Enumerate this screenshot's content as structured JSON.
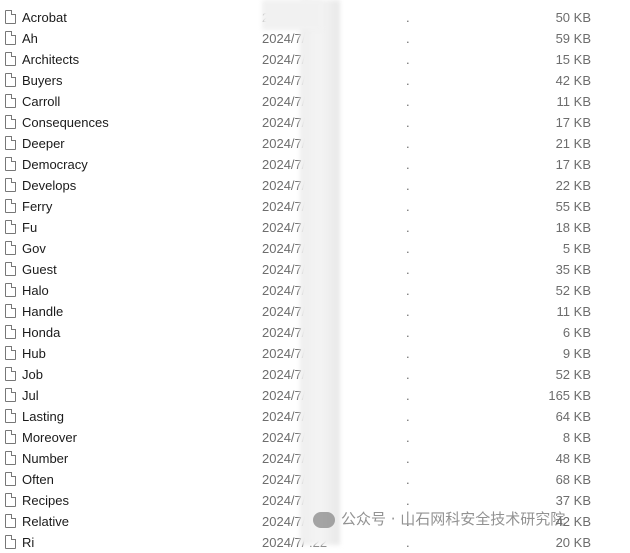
{
  "files": [
    {
      "name": "Acrobat",
      "date": "2024/7/ 3:22",
      "type": ".",
      "size": "50 KB"
    },
    {
      "name": "Ah",
      "date": "2024/7/ 3:22",
      "type": ".",
      "size": "59 KB"
    },
    {
      "name": "Architects",
      "date": "2024/7/ :22",
      "type": ".",
      "size": "15 KB"
    },
    {
      "name": "Buyers",
      "date": "2024/7/ :22",
      "type": ".",
      "size": "42 KB"
    },
    {
      "name": "Carroll",
      "date": "2024/7/ :22",
      "type": ".",
      "size": "11 KB"
    },
    {
      "name": "Consequences",
      "date": "2024/7/ :22",
      "type": ".",
      "size": "17 KB"
    },
    {
      "name": "Deeper",
      "date": "2024/7/ :22",
      "type": ".",
      "size": "21 KB"
    },
    {
      "name": "Democracy",
      "date": "2024/7/ :22",
      "type": ".",
      "size": "17 KB"
    },
    {
      "name": "Develops",
      "date": "2024/7/ :22",
      "type": ".",
      "size": "22 KB"
    },
    {
      "name": "Ferry",
      "date": "2024/7/ :22",
      "type": ".",
      "size": "55 KB"
    },
    {
      "name": "Fu",
      "date": "2024/7/ :22",
      "type": ".",
      "size": "18 KB"
    },
    {
      "name": "Gov",
      "date": "2024/7/ :22",
      "type": ".",
      "size": "5 KB"
    },
    {
      "name": "Guest",
      "date": "2024/7/ :22",
      "type": ".",
      "size": "35 KB"
    },
    {
      "name": "Halo",
      "date": "2024/7/ :22",
      "type": ".",
      "size": "52 KB"
    },
    {
      "name": "Handle",
      "date": "2024/7/ 3:22",
      "type": ".",
      "size": "11 KB"
    },
    {
      "name": "Honda",
      "date": "2024/7/ 3:22",
      "type": ".",
      "size": "6 KB"
    },
    {
      "name": "Hub",
      "date": "2024/7/ :22",
      "type": ".",
      "size": "9 KB"
    },
    {
      "name": "Job",
      "date": "2024/7/ :22",
      "type": ".",
      "size": "52 KB"
    },
    {
      "name": "Jul",
      "date": "2024/7/ :22",
      "type": ".",
      "size": "165 KB"
    },
    {
      "name": "Lasting",
      "date": "2024/7/ :22",
      "type": ".",
      "size": "64 KB"
    },
    {
      "name": "Moreover",
      "date": "2024/7/ :22",
      "type": ".",
      "size": "8 KB"
    },
    {
      "name": "Number",
      "date": "2024/7/ :22",
      "type": ".",
      "size": "48 KB"
    },
    {
      "name": "Often",
      "date": "2024/7/ :22",
      "type": ".",
      "size": "68 KB"
    },
    {
      "name": "Recipes",
      "date": "2024/7/ :22",
      "type": ".",
      "size": "37 KB"
    },
    {
      "name": "Relative",
      "date": "2024/7/ :22",
      "type": ".",
      "size": "42 KB"
    },
    {
      "name": "Ri",
      "date": "2024/7/ :22",
      "type": ".",
      "size": "20 KB"
    }
  ],
  "watermark": "公众号 · 山石网科安全技术研究院"
}
